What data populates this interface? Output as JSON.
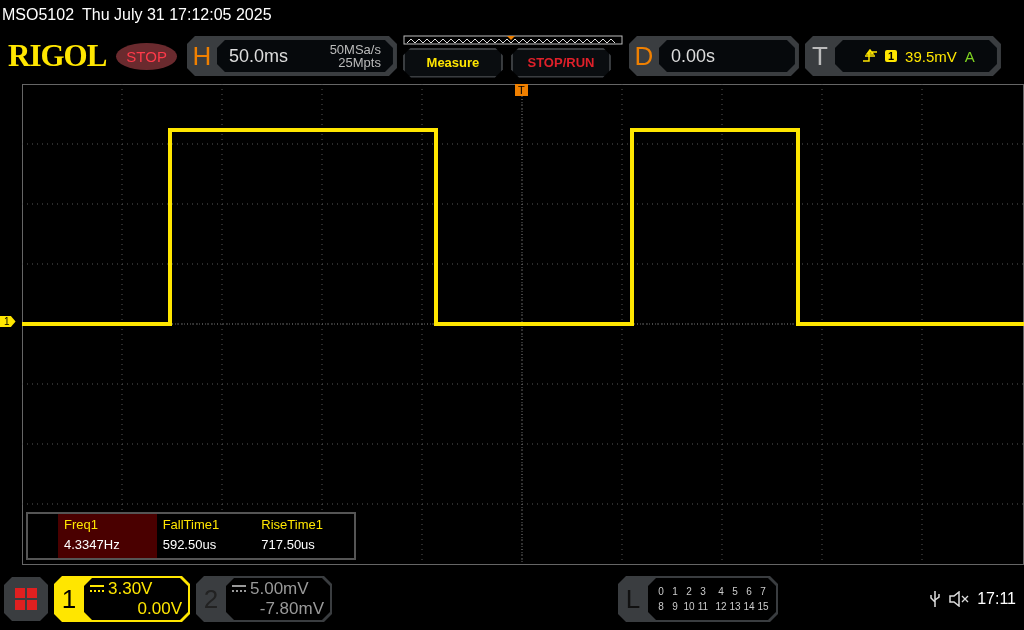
{
  "status_line": {
    "model": "MSO5102",
    "datetime": "Thu July 31 17:12:05 2025"
  },
  "top_bar": {
    "logo": "RIGOL",
    "run_state": {
      "label": "STOP",
      "kind": "stopped"
    },
    "horizontal": {
      "letter": "H",
      "timebase": "50.0ms",
      "sample_rate": "50MSa/s",
      "memory_depth": "25Mpts"
    },
    "buttons": [
      {
        "label": "Measure",
        "kind": "menu"
      },
      {
        "label": "STOP/RUN",
        "kind": "run"
      }
    ],
    "delay": {
      "letter": "D",
      "value": "0.00s"
    },
    "trigger": {
      "letter": "T",
      "source": "1",
      "level": "39.5mV",
      "mode": "A"
    }
  },
  "plot": {
    "channel_marker": "1",
    "trigger_marker": "T"
  },
  "measurements": [
    {
      "name": "Freq1",
      "value": "4.3347Hz",
      "selected": true
    },
    {
      "name": "FallTime1",
      "value": "592.50us",
      "selected": false
    },
    {
      "name": "RiseTime1",
      "value": "717.50us",
      "selected": false
    }
  ],
  "channels": [
    {
      "number": "1",
      "scale": "3.30V",
      "offset": "0.00V",
      "active": true
    },
    {
      "number": "2",
      "scale": "5.00mV",
      "offset": "-7.80mV",
      "active": false
    }
  ],
  "logic": {
    "letter": "L",
    "rows": [
      [
        "0",
        "1",
        "2",
        "3",
        "4",
        "5",
        "6",
        "7"
      ],
      [
        "8",
        "9",
        "10",
        "11",
        "12",
        "13",
        "14",
        "15"
      ]
    ]
  },
  "status_bar": {
    "time": "17:11"
  }
}
